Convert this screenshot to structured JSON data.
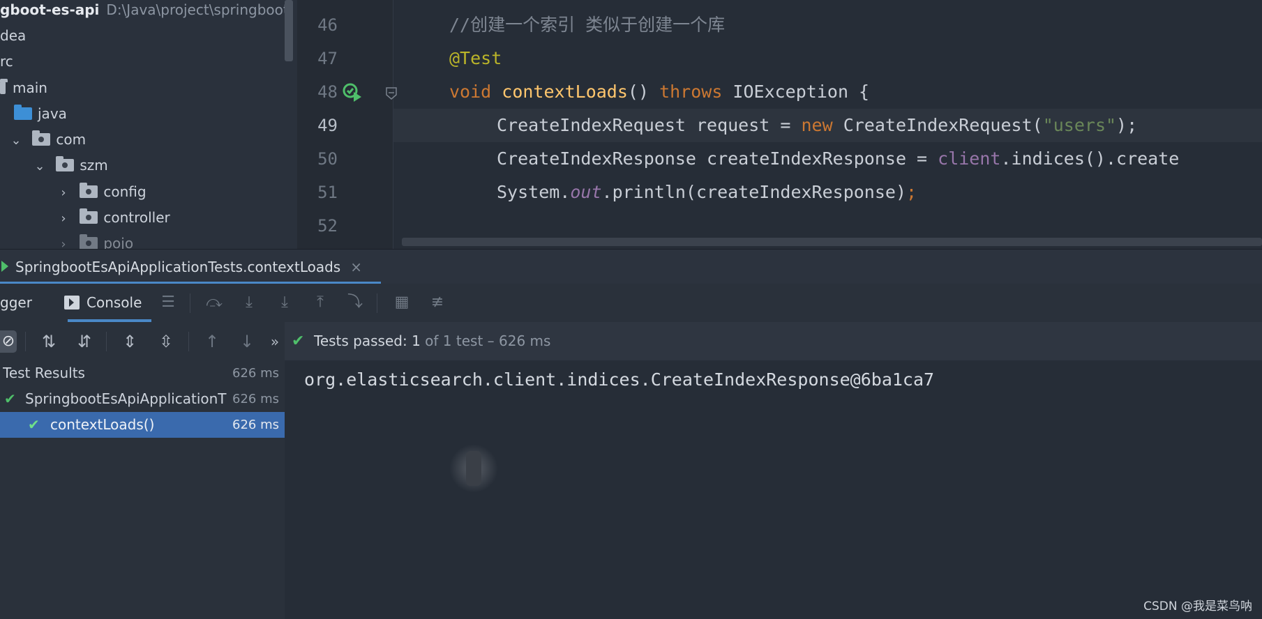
{
  "project": {
    "root_name": "gboot-es-api",
    "root_path": "D:\\Java\\project\\springboot-",
    "items": [
      {
        "label": "dea"
      },
      {
        "label": "rc"
      },
      {
        "label": "main"
      },
      {
        "label": "java"
      },
      {
        "label": "com"
      },
      {
        "label": "szm"
      },
      {
        "label": "config"
      },
      {
        "label": "controller"
      },
      {
        "label": "pojo"
      }
    ]
  },
  "editor": {
    "line_numbers": [
      "46",
      "47",
      "48",
      "49",
      "50",
      "51",
      "52"
    ],
    "active_line": "49",
    "lines": {
      "l46": "//创建一个索引 类似于创建一个库",
      "l47": "@Test",
      "l48_kw": "void",
      "l48_fn": "contextLoads",
      "l48_paren": "() ",
      "l48_throws": "throws",
      "l48_rest": " IOException {",
      "l49_a": "CreateIndexRequest request = ",
      "l49_new": "new",
      "l49_b": " CreateIndexRequest(",
      "l49_str": "\"users\"",
      "l49_c": ");",
      "l50_a": "CreateIndexResponse createIndexResponse = ",
      "l50_client": "client",
      "l50_b": ".indices().create",
      "l51_a": "System.",
      "l51_out": "out",
      "l51_b": ".println(createIndexResponse)",
      "l51_c": ";"
    }
  },
  "run": {
    "tab_title": "SpringbootEsApiApplicationTests.contextLoads",
    "close_glyph": "×",
    "debugger_label": "gger",
    "console_label": "Console",
    "status_prefix": "Tests passed: ",
    "status_count": "1",
    "status_suffix": " of 1 test – 626 ms",
    "results": [
      {
        "name": "Test Results",
        "time": "626 ms"
      },
      {
        "name": "SpringbootEsApiApplicationT",
        "time": "626 ms"
      },
      {
        "name": "contextLoads()",
        "time": "626 ms"
      }
    ],
    "console_output": "org.elasticsearch.client.indices.CreateIndexResponse@6ba1ca7"
  },
  "watermark": "CSDN @我是菜鸟呐",
  "colors": {
    "accent": "#4a88c7",
    "pass": "#4fbf6a",
    "selection": "#3a6aad"
  }
}
